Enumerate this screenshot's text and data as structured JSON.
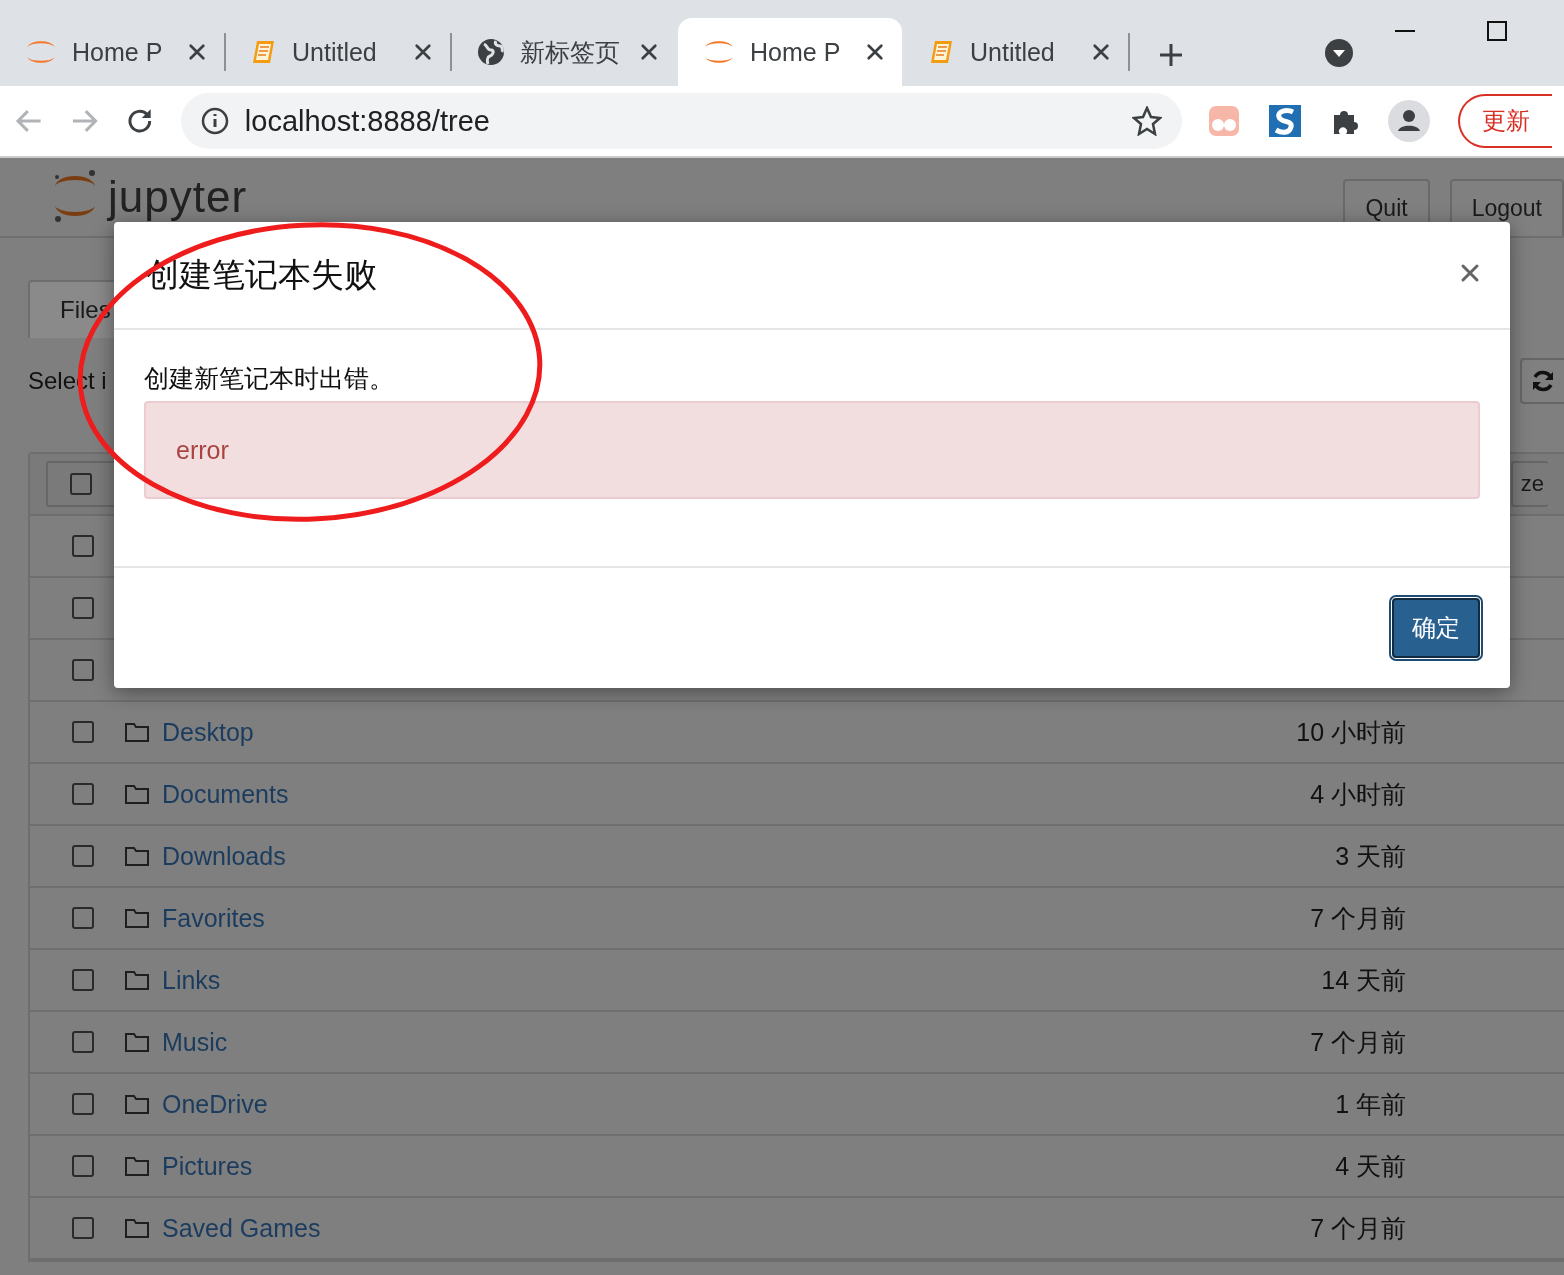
{
  "browser": {
    "tabs": [
      {
        "title": "Home P",
        "kind": "jupyter",
        "selected": false
      },
      {
        "title": "Untitled",
        "kind": "notebook",
        "selected": false
      },
      {
        "title": "新标签页",
        "kind": "globe",
        "selected": false
      },
      {
        "title": "Home P",
        "kind": "jupyter",
        "selected": true
      },
      {
        "title": "Untitled",
        "kind": "notebook",
        "selected": false
      }
    ],
    "url": "localhost:8888/tree",
    "update_button": "更新"
  },
  "header": {
    "logo": "jupyter",
    "buttons": [
      "Quit",
      "Logout"
    ]
  },
  "tabs": [
    {
      "label": "Files",
      "selected": true
    }
  ],
  "toolbar": {
    "text": "Select i"
  },
  "list": {
    "header": {
      "checked": false,
      "column_2": "ze"
    },
    "rows": [
      {
        "checked": false
      },
      {
        "checked": false
      },
      {
        "checked": false
      },
      {
        "name": "Desktop",
        "modified": "10 小时前",
        "checked": false
      },
      {
        "name": "Documents",
        "modified": "4 小时前",
        "checked": false
      },
      {
        "name": "Downloads",
        "modified": "3 天前",
        "checked": false
      },
      {
        "name": "Favorites",
        "modified": "7 个月前",
        "checked": false
      },
      {
        "name": "Links",
        "modified": "14 天前",
        "checked": false
      },
      {
        "name": "Music",
        "modified": "7 个月前",
        "checked": false
      },
      {
        "name": "OneDrive",
        "modified": "1 年前",
        "checked": false
      },
      {
        "name": "Pictures",
        "modified": "4 天前",
        "checked": false
      },
      {
        "name": "Saved Games",
        "modified": "7 个月前",
        "checked": false
      }
    ]
  },
  "dialog": {
    "title": "创建笔记本失败",
    "message": "创建新笔记本时出错。",
    "error": "error",
    "button": "确定"
  }
}
